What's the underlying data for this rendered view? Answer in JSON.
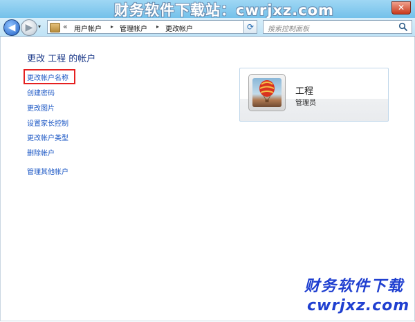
{
  "watermark": {
    "top": "财务软件下载站：cwrjxz.com",
    "bottom_line1": "财务软件下载",
    "bottom_line2": "cwrjxz.com"
  },
  "titlebar": {
    "close_glyph": "✕"
  },
  "nav": {
    "back_glyph": "◀",
    "forward_glyph": "▶",
    "history_glyph": "▾",
    "address_chevron": "«",
    "breadcrumbs": [
      "用户帐户",
      "管理帐户",
      "更改帐户"
    ],
    "breadcrumb_sep": "▸",
    "address_dropdown_glyph": "▾",
    "refresh_glyph": "⟳",
    "search_placeholder": "搜索控制面板"
  },
  "page": {
    "title": "更改 工程 的帐户",
    "tasks": [
      {
        "label": "更改帐户名称",
        "highlighted": true
      },
      {
        "label": "创建密码"
      },
      {
        "label": "更改图片"
      },
      {
        "label": "设置家长控制"
      },
      {
        "label": "更改帐户类型"
      },
      {
        "label": "删除帐户"
      },
      {
        "label": "管理其他帐户"
      }
    ]
  },
  "account": {
    "name": "工程",
    "role": "管理员",
    "picture": "hot-air-balloon"
  },
  "colors": {
    "link": "#1a56c4",
    "title": "#1e3b8a",
    "highlight": "#e52020",
    "watermark": "#1f3fd0"
  }
}
